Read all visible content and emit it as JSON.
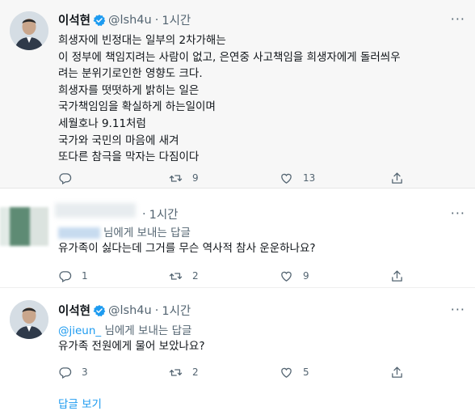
{
  "tweet1": {
    "name": "이석현",
    "handle": "@lsh4u",
    "time": "1시간",
    "lines": [
      "희생자에 빈정대는 일부의 2차가해는",
      "이 정부에 책임지려는 사람이 없고, 은연중 사고책임을 희생자에게 돌러씌우",
      "려는 분위기로인한 영향도 크다.",
      "희생자를 떳떳하게 밝히는 일은",
      "국가책임임을 확실하게 하는일이며",
      "세월호나 9.11처럼",
      "국가와 국민의 마음에 새겨",
      "또다른 참극을 막자는 다짐이다"
    ],
    "replies": "",
    "retweets": "9",
    "likes": "13"
  },
  "tweet2": {
    "time": "1시간",
    "reply_to_suffix": "님에게 보내는 답글",
    "text": "유가족이 싫다는데 그거를 무슨 역사적 참사 운운하나요?",
    "replies": "1",
    "retweets": "2",
    "likes": "9"
  },
  "tweet3": {
    "name": "이석현",
    "handle": "@lsh4u",
    "time": "1시간",
    "reply_to_handle": "@jieun_",
    "reply_to_suffix": "님에게 보내는 답글",
    "text": "유가족 전원에게 물어 보았나요?",
    "replies": "3",
    "retweets": "2",
    "likes": "5"
  },
  "show_replies_label": "답글 보기",
  "colors": {
    "accent": "#1d9bf0",
    "muted": "#536471",
    "text": "#0f1419"
  },
  "icons": [
    "reply-icon",
    "retweet-icon",
    "like-icon",
    "share-icon",
    "verified-icon",
    "more-icon"
  ]
}
